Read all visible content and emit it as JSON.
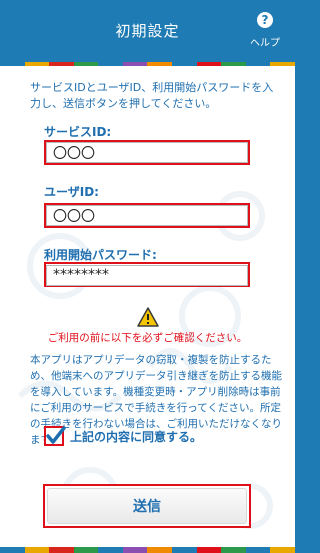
{
  "header": {
    "title": "初期設定",
    "help_label": "ヘルプ",
    "help_icon": "help-icon"
  },
  "colors": {
    "primary": "#1f7bb3",
    "text_blue": "#1f6fb0",
    "highlight_red": "#e0101a",
    "stripe": [
      "#1f7bb3",
      "#e8a800",
      "#d9261c",
      "#2c9a4a",
      "#8a4fb0",
      "#1f7bb3",
      "#f08a00",
      "#e0101a"
    ]
  },
  "form": {
    "intro": "サービスIDとユーザID、利用開始パスワードを入力し、送信ボタンを押してください。",
    "service_id": {
      "label": "サービスID:",
      "value": "〇〇〇"
    },
    "user_id": {
      "label": "ユーザID:",
      "value": "〇〇〇"
    },
    "password": {
      "label": "利用開始パスワード:",
      "value": "********"
    }
  },
  "notice": {
    "icon": "warning-icon",
    "caution": "ご利用の前に以下を必ずご確認ください。",
    "text": "本アプリはアプリデータの窃取・複製を防止するため、他端末へのアプリデータ引き継ぎを防止する機能を導入しています。機種変更時・アプリ削除時は事前にご利用のサービスで手続きを行ってください。所定の手続きを行わない場合は、ご利用いただけなくなります。"
  },
  "agreement": {
    "label": "上記の内容に同意する。",
    "checked": true
  },
  "submit": {
    "label": "送信"
  }
}
